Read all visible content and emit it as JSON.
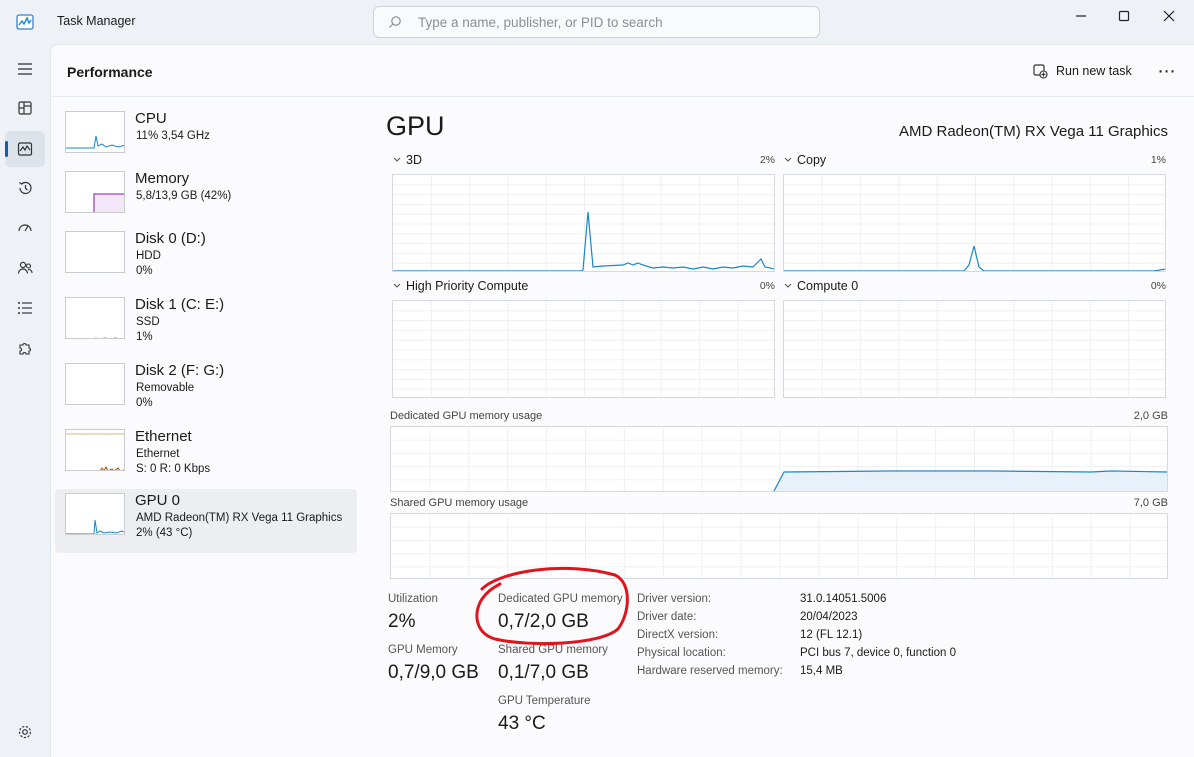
{
  "app": {
    "title": "Task Manager"
  },
  "search": {
    "placeholder": "Type a name, publisher, or PID to search"
  },
  "header": {
    "title": "Performance",
    "run_new_task": "Run new task",
    "more": "⋯"
  },
  "nav": {
    "items": [
      "menu",
      "processes",
      "performance",
      "app-history",
      "startup-apps",
      "users",
      "details",
      "services",
      "settings"
    ],
    "active": "performance"
  },
  "list": [
    {
      "title": "CPU",
      "sub1": "11% 3,54 GHz",
      "sub2": "",
      "color": "#1a87c9"
    },
    {
      "title": "Memory",
      "sub1": "5,8/13,9 GB (42%)",
      "sub2": "",
      "color": "#8b12ae"
    },
    {
      "title": "Disk 0 (D:)",
      "sub1": "HDD",
      "sub2": "0%",
      "color": "#4da60c"
    },
    {
      "title": "Disk 1 (C: E:)",
      "sub1": "SSD",
      "sub2": "1%",
      "color": "#4da60c"
    },
    {
      "title": "Disk 2 (F: G:)",
      "sub1": "Removable",
      "sub2": "0%",
      "color": "#4da60c"
    },
    {
      "title": "Ethernet",
      "sub1": "Ethernet",
      "sub2": "S: 0 R: 0 Kbps",
      "color": "#a74f01"
    },
    {
      "title": "GPU 0",
      "sub1": "AMD Radeon(TM) RX Vega 11 Graphics",
      "sub2": "2% (43 °C)",
      "color": "#1a87c9"
    }
  ],
  "gpu": {
    "title": "GPU",
    "name": "AMD Radeon(TM) RX Vega 11 Graphics",
    "engines": [
      {
        "label": "3D",
        "pct": "2%"
      },
      {
        "label": "Copy",
        "pct": "1%"
      },
      {
        "label": "High Priority Compute",
        "pct": "0%"
      },
      {
        "label": "Compute 0",
        "pct": "0%"
      }
    ],
    "dedicated_label": "Dedicated GPU memory usage",
    "dedicated_max": "2,0 GB",
    "shared_label": "Shared GPU memory usage",
    "shared_max": "7,0 GB"
  },
  "stats": {
    "utilization": {
      "label": "Utilization",
      "value": "2%"
    },
    "dedicated": {
      "label": "Dedicated GPU memory",
      "value": "0,7/2,0 GB"
    },
    "gpu_memory": {
      "label": "GPU Memory",
      "value": "0,7/9,0 GB"
    },
    "shared": {
      "label": "Shared GPU memory",
      "value": "0,1/7,0 GB"
    },
    "temperature": {
      "label": "GPU Temperature",
      "value": "43 °C"
    }
  },
  "properties": [
    {
      "label": "Driver version:",
      "value": "31.0.14051.5006"
    },
    {
      "label": "Driver date:",
      "value": "20/04/2023"
    },
    {
      "label": "DirectX version:",
      "value": "12 (FL 12.1)"
    },
    {
      "label": "Physical location:",
      "value": "PCI bus 7, device 0, function 0"
    },
    {
      "label": "Hardware reserved memory:",
      "value": "15,4 MB"
    }
  ],
  "colors": {
    "accent": "#0a5fb8",
    "gpu_line": "#1a87c9",
    "annotation": "#e0141c"
  }
}
